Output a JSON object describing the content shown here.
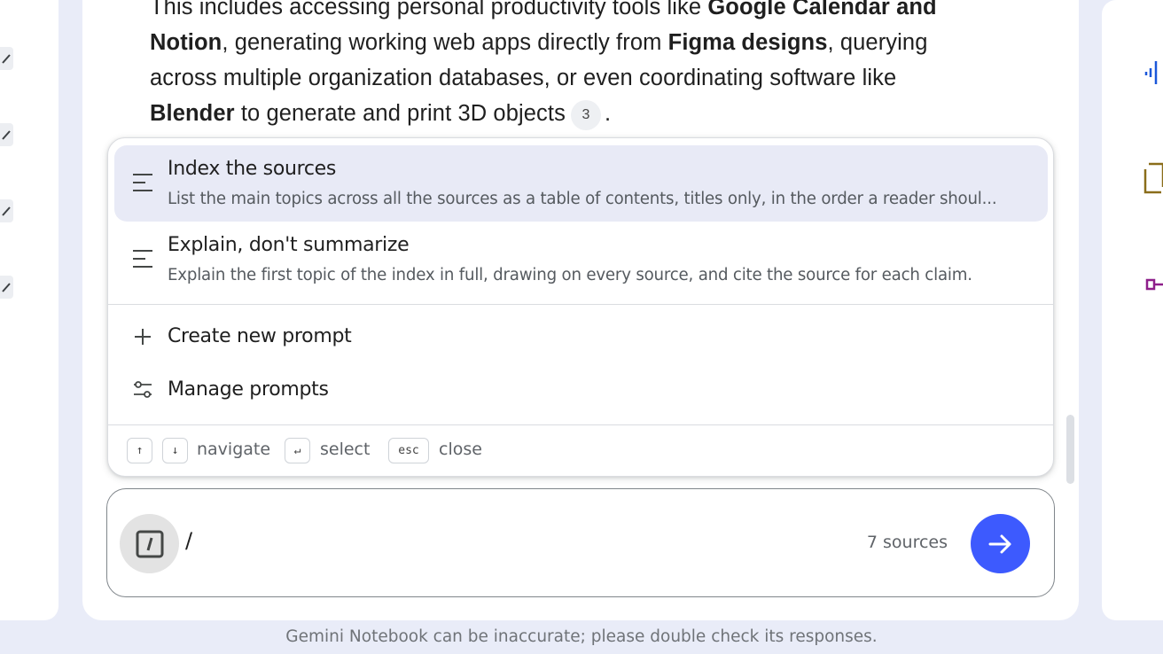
{
  "answer": {
    "line1_prefix": "This includes accessing personal productivity tools like ",
    "line1_bold": "Google Calendar and",
    "line2_bold": "Notion",
    "line2_text": ", generating working web apps directly from ",
    "line2_bold2": "Figma designs",
    "line2_suffix": ", querying",
    "line3_text": "across multiple organization databases, or even coordinating software like",
    "line4_bold": "Blender",
    "line4_text": " to generate and print 3D objects",
    "citation": "3",
    "line4_end": "."
  },
  "prompt_menu": {
    "items": [
      {
        "title": "Index the sources",
        "description": "List the main topics across all the sources as a table of contents, titles only, in the order a reader shoul...",
        "icon": "lines-icon"
      },
      {
        "title": "Explain, don't summarize",
        "description": "Explain the first topic of the index in full, drawing on every source, and cite the source for each claim.",
        "icon": "lines-icon"
      }
    ],
    "actions": {
      "create": {
        "label": "Create new prompt",
        "icon": "plus-icon"
      },
      "manage": {
        "label": "Manage prompts",
        "icon": "sliders-icon"
      }
    },
    "hints": {
      "up_key": "↑",
      "down_key": "↓",
      "navigate": "navigate",
      "enter_key": "↵",
      "select": "select",
      "esc_key": "esc",
      "close": "close"
    }
  },
  "input": {
    "value": "/",
    "sources": "7 sources"
  },
  "footer": {
    "disclaimer": "Gemini Notebook can be inaccurate; please double check its responses."
  },
  "colors": {
    "accent": "#3d5afe",
    "highlight": "#e8eaf6",
    "page_bg": "#e9ecf8"
  }
}
